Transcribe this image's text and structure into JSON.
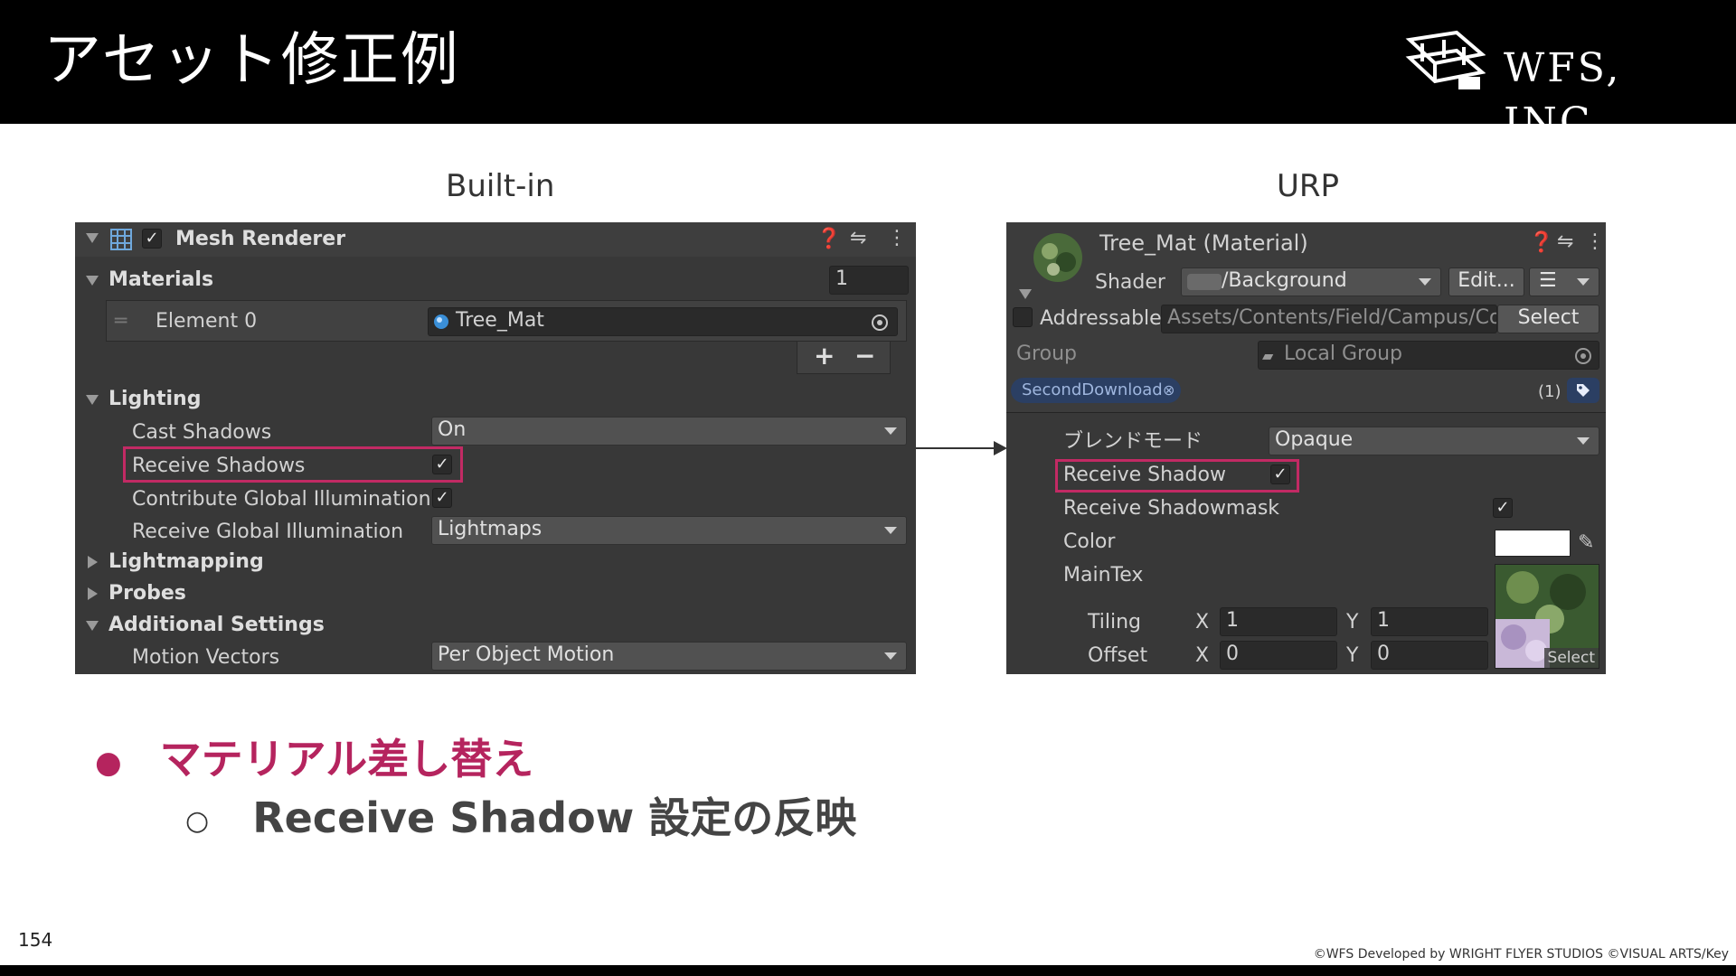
{
  "slide": {
    "title": "アセット修正例",
    "company": "WFS, INC.",
    "page_number": "154",
    "copyright": "©WFS Developed by WRIGHT FLYER STUDIOS ©VISUAL ARTS/Key",
    "builtin_label": "Built-in",
    "urp_label": "URP"
  },
  "builtin": {
    "component_title": "Mesh Renderer",
    "materials_label": "Materials",
    "materials_count": "1",
    "element0_label": "Element 0",
    "element0_value": "Tree_Mat",
    "plus": "+",
    "minus": "−",
    "lighting_label": "Lighting",
    "cast_shadows_label": "Cast Shadows",
    "cast_shadows_value": "On",
    "receive_shadows_label": "Receive Shadows",
    "contribute_gi_label": "Contribute Global Illumination",
    "receive_gi_label": "Receive Global Illumination",
    "receive_gi_value": "Lightmaps",
    "lightmapping_label": "Lightmapping",
    "probes_label": "Probes",
    "additional_label": "Additional Settings",
    "motion_vectors_label": "Motion Vectors",
    "motion_vectors_value": "Per Object Motion"
  },
  "urp": {
    "material_title": "Tree_Mat (Material)",
    "shader_label": "Shader",
    "shader_value": "/Background",
    "edit_button": "Edit...",
    "addressable_label": "Addressable",
    "addressable_path": "Assets/Contents/Field/Campus/Co",
    "select_button": "Select",
    "group_label": "Group",
    "group_value": "Local Group",
    "tag_label": "SecondDownload",
    "tag_count": "(1)",
    "blend_mode_label": "ブレンドモード",
    "blend_mode_value": "Opaque",
    "receive_shadow_label": "Receive Shadow",
    "receive_shadowmask_label": "Receive Shadowmask",
    "color_label": "Color",
    "maintex_label": "MainTex",
    "tiling_label": "Tiling",
    "offset_label": "Offset",
    "x_label": "X",
    "y_label": "Y",
    "tiling_x": "1",
    "tiling_y": "1",
    "offset_x": "0",
    "offset_y": "0",
    "tex_select": "Select"
  },
  "bullets": {
    "main": "マテリアル差し替え",
    "sub": "Receive Shadow 設定の反映"
  },
  "colors": {
    "accent": "#c22a64",
    "panel_bg": "#383838"
  }
}
